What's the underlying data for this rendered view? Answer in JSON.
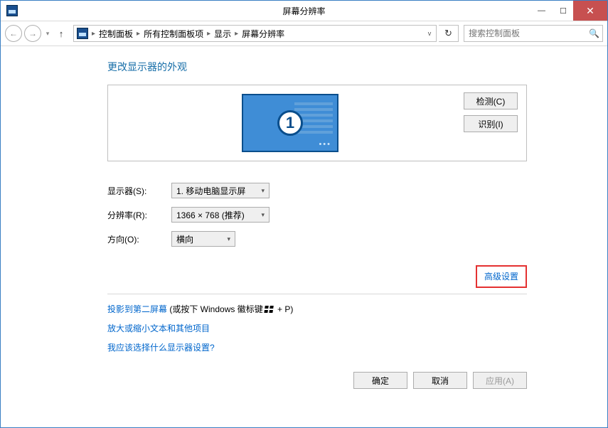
{
  "window": {
    "title": "屏幕分辨率"
  },
  "nav": {
    "breadcrumb": [
      "控制面板",
      "所有控制面板项",
      "显示",
      "屏幕分辨率"
    ],
    "search_placeholder": "搜索控制面板"
  },
  "page": {
    "heading": "更改显示器的外观",
    "detect_btn": "检测(C)",
    "identify_btn": "识别(I)",
    "monitor_number": "1",
    "display_label": "显示器(S):",
    "display_value": "1. 移动电脑显示屏",
    "resolution_label": "分辨率(R):",
    "resolution_value": "1366 × 768 (推荐)",
    "orientation_label": "方向(O):",
    "orientation_value": "横向",
    "advanced_link": "高级设置",
    "project_prefix": "投影到第二屏幕",
    "project_suffix": " (或按下 Windows 徽标键",
    "project_tail": " + P)",
    "textsize_link": "放大或缩小文本和其他项目",
    "whichsettings_link": "我应该选择什么显示器设置?",
    "ok_btn": "确定",
    "cancel_btn": "取消",
    "apply_btn": "应用(A)"
  }
}
